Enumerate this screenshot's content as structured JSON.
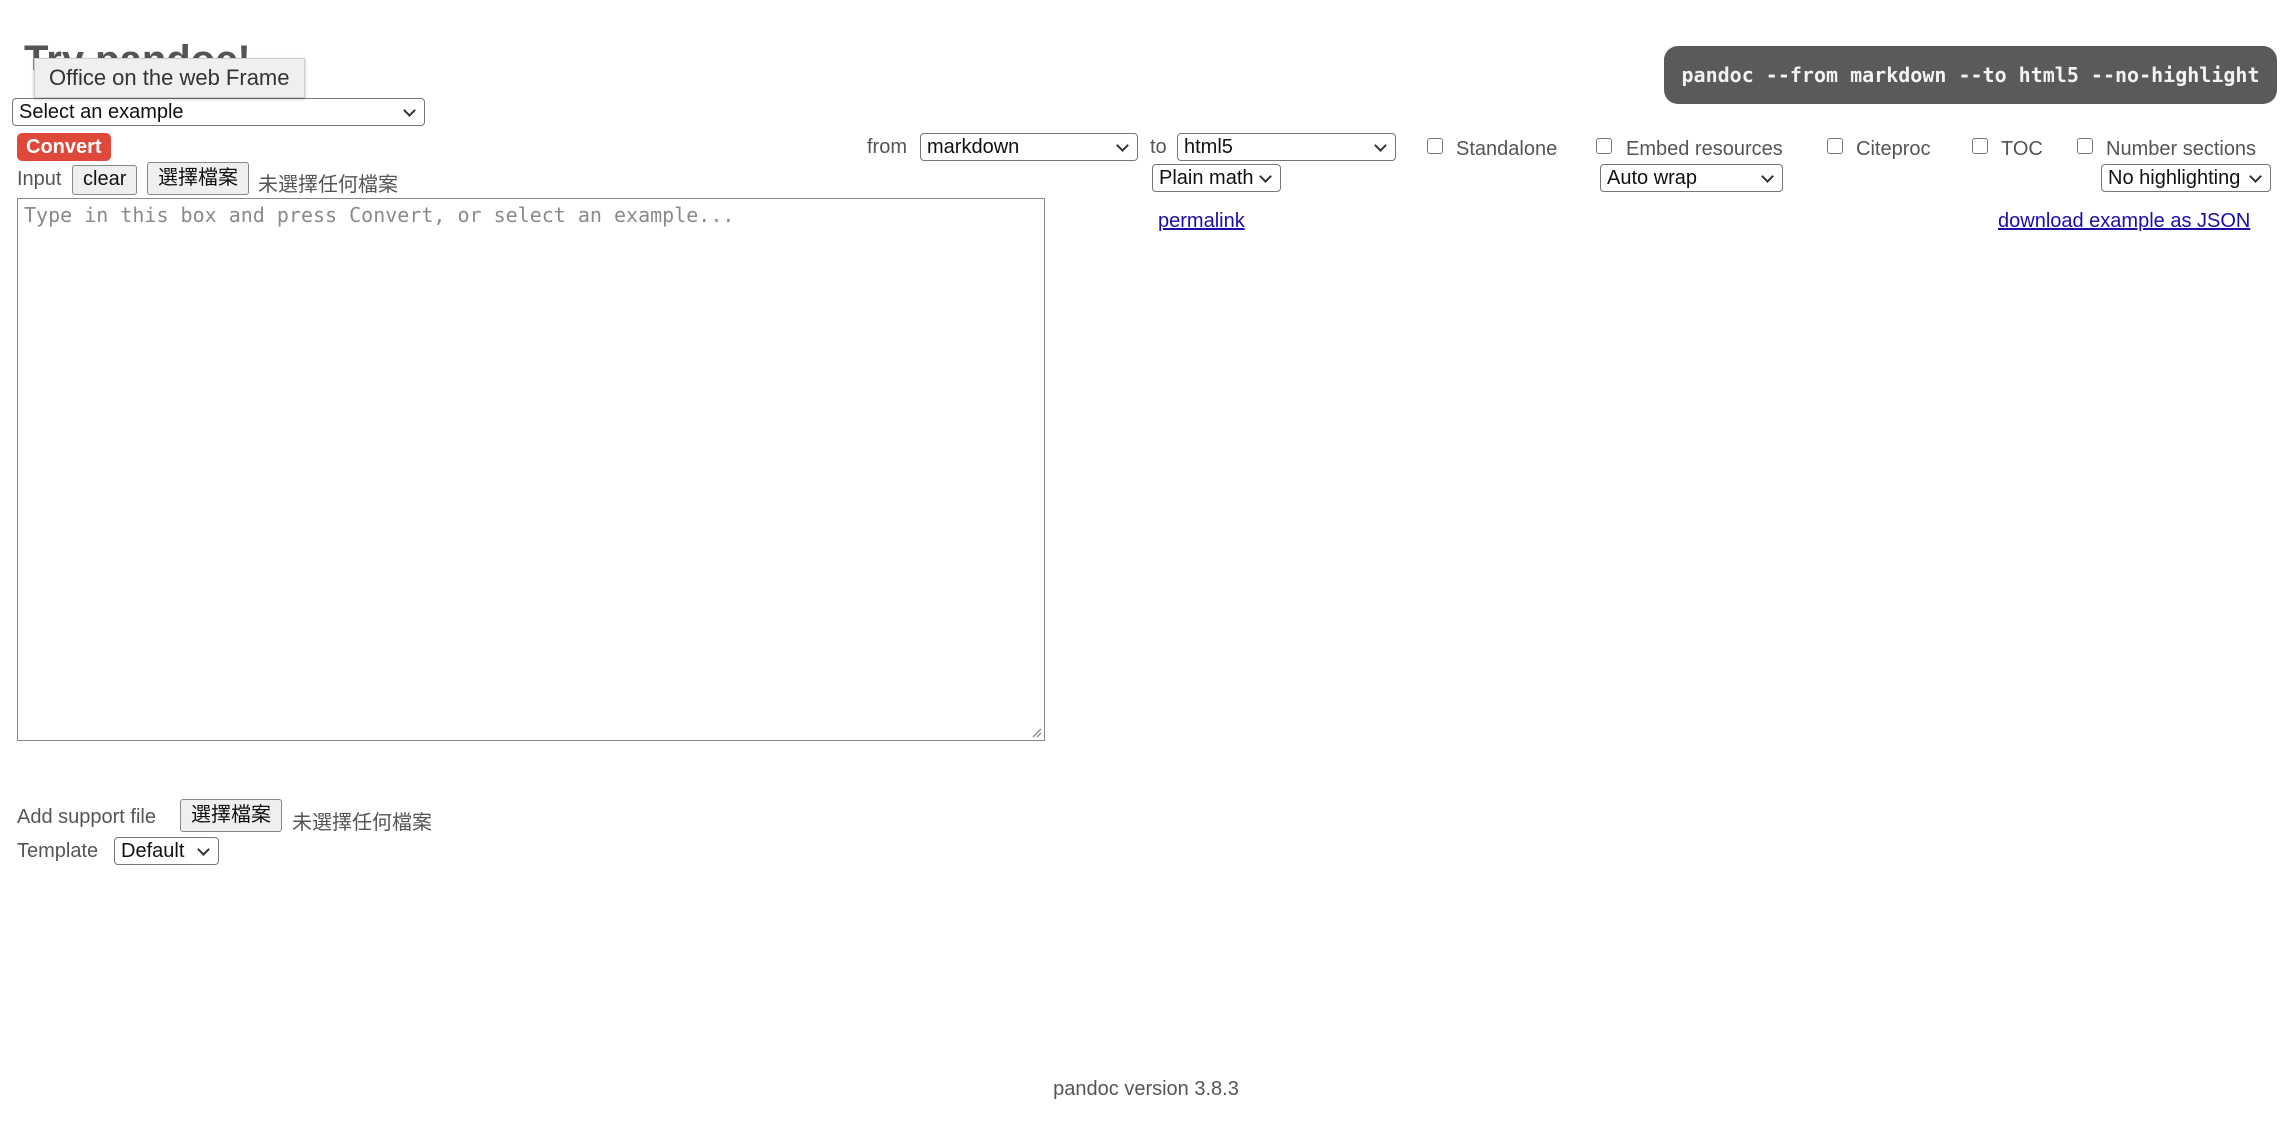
{
  "page": {
    "title": "Try pandoc!"
  },
  "tooltip": {
    "text": "Office on the web Frame"
  },
  "command": {
    "text": "pandoc --from markdown --to html5 --no-highlight"
  },
  "examples": {
    "selected": "Select an example"
  },
  "convert": {
    "label": "Convert"
  },
  "input": {
    "label": "Input",
    "clear_label": "clear",
    "choose_file_label": "選擇檔案",
    "no_file_text": "未選擇任何檔案",
    "placeholder": "Type in this box and press Convert, or select an example..."
  },
  "options": {
    "from_label": "from",
    "from_value": "markdown",
    "to_label": "to",
    "to_value": "html5",
    "math_value": "Plain math",
    "wrap_value": "Auto wrap",
    "highlight_value": "No highlighting",
    "checkboxes": [
      {
        "label": "Standalone",
        "checked": false
      },
      {
        "label": "Embed resources",
        "checked": false
      },
      {
        "label": "Citeproc",
        "checked": false
      },
      {
        "label": "TOC",
        "checked": false
      },
      {
        "label": "Number sections",
        "checked": false
      }
    ]
  },
  "links": {
    "permalink": "permalink",
    "download": "download example as JSON"
  },
  "support_file": {
    "label": "Add support file",
    "choose_file_label": "選擇檔案",
    "no_file_text": "未選擇任何檔案"
  },
  "template": {
    "label": "Template",
    "value": "Default"
  },
  "footer": {
    "version_text": "pandoc version 3.8.3"
  }
}
